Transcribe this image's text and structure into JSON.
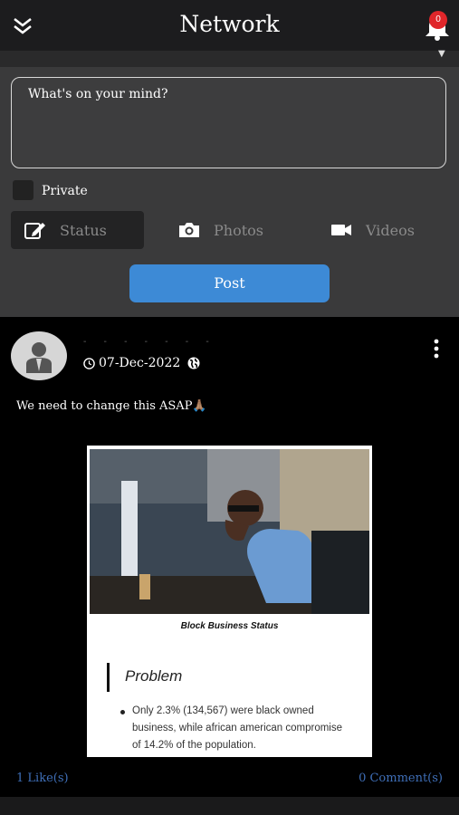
{
  "header": {
    "title": "Network",
    "menu_icon": "double-chevron-down-icon",
    "bell_icon": "bell-icon",
    "notification_count": "0"
  },
  "composer": {
    "placeholder": "What's on your mind?",
    "private_label": "Private",
    "tabs": [
      {
        "label": "Status",
        "icon": "edit-icon",
        "active": true
      },
      {
        "label": "Photos",
        "icon": "camera-icon",
        "active": false
      },
      {
        "label": "Videos",
        "icon": "video-icon",
        "active": false
      }
    ],
    "post_label": "Post"
  },
  "post": {
    "username": "- - - - - - -",
    "date": "07-Dec-2022",
    "text": "We need to change this ASAP🙏🏽",
    "image": {
      "caption": "Block Business Status",
      "heading": "Problem",
      "bullet": "Only 2.3% (134,567) were black owned business, while african american compromise of 14.2% of the population."
    },
    "likes": "1 Like(s)",
    "comments": "0 Comment(s)"
  },
  "colors": {
    "accent": "#3d8ad6",
    "link": "#3f6fb8",
    "badge": "#e0262a"
  }
}
